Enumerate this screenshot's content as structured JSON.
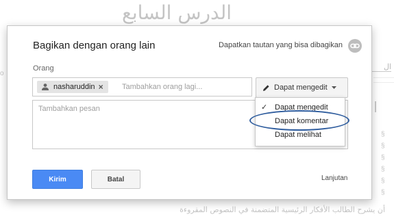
{
  "background": {
    "title": "الدرس السابع",
    "heading": "ال",
    "footer_text": "أن يشرح الطالب الأفكار الرئيسية المتضمنة في النصوص المقروءة",
    "bullet_glyph": "§"
  },
  "dialog": {
    "title": "Bagikan dengan orang lain",
    "share_link_label": "Dapatkan tautan yang bisa dibagikan",
    "people_label": "Orang",
    "chip_name": "nasharuddin",
    "chip_remove": "×",
    "people_placeholder": "Tambahkan orang lagi...",
    "permission_button": "Dapat mengedit",
    "message_placeholder": "Tambahkan pesan",
    "permission_options": [
      {
        "label": "Dapat mengedit",
        "selected": true
      },
      {
        "label": "Dapat komentar",
        "selected": false
      },
      {
        "label": "Dapat melihat",
        "selected": false
      }
    ],
    "check_glyph": "✓",
    "send_label": "Kirim",
    "cancel_label": "Batal",
    "advanced_label": "Lanjutan"
  },
  "colors": {
    "primary_button": "#4a8af4",
    "highlight_ring": "#2f5d9e"
  },
  "icons": {
    "share_link": "link-icon",
    "person": "person-icon",
    "edit": "pencil-icon",
    "dropdown": "caret-down-icon"
  }
}
